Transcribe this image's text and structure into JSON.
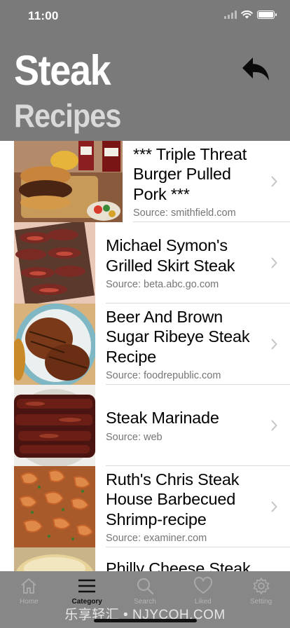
{
  "status_bar": {
    "time": "11:00",
    "icons": [
      "signal-icon",
      "wifi-icon",
      "battery-icon"
    ]
  },
  "header": {
    "title_line1": "Steak",
    "title_line2": "Recipes",
    "back_icon": "reply-arrow-icon",
    "background_color": "#7a7a7a"
  },
  "recipes": [
    {
      "title": "*** Triple Threat Burger Pulled Pork ***",
      "source": "Source: smithfield.com",
      "thumb": "burger-photo"
    },
    {
      "title": "Michael Symon's Grilled Skirt Steak",
      "source": "Source: beta.abc.go.com",
      "thumb": "skirt-steak-photo"
    },
    {
      "title": "Beer And Brown Sugar Ribeye Steak Recipe",
      "source": "Source: foodrepublic.com",
      "thumb": "ribeye-photo"
    },
    {
      "title": "Steak Marinade",
      "source": "Source: web",
      "thumb": "marinated-steak-photo"
    },
    {
      "title": "Ruth's Chris Steak House Barbecued Shrimp-recipe",
      "source": "Source: examiner.com",
      "thumb": "shrimp-photo"
    },
    {
      "title": "Philly Cheese Steak",
      "source": "",
      "thumb": "philly-photo"
    }
  ],
  "tabbar": {
    "tabs": [
      {
        "label": "Home",
        "icon": "home-icon"
      },
      {
        "label": "Category",
        "icon": "menu-icon"
      },
      {
        "label": "Search",
        "icon": "search-icon"
      },
      {
        "label": "Liked",
        "icon": "heart-icon"
      },
      {
        "label": "Setting",
        "icon": "gear-icon"
      }
    ],
    "active": "Category"
  },
  "watermark": "乐享轻汇 • NJYCQH.COM"
}
